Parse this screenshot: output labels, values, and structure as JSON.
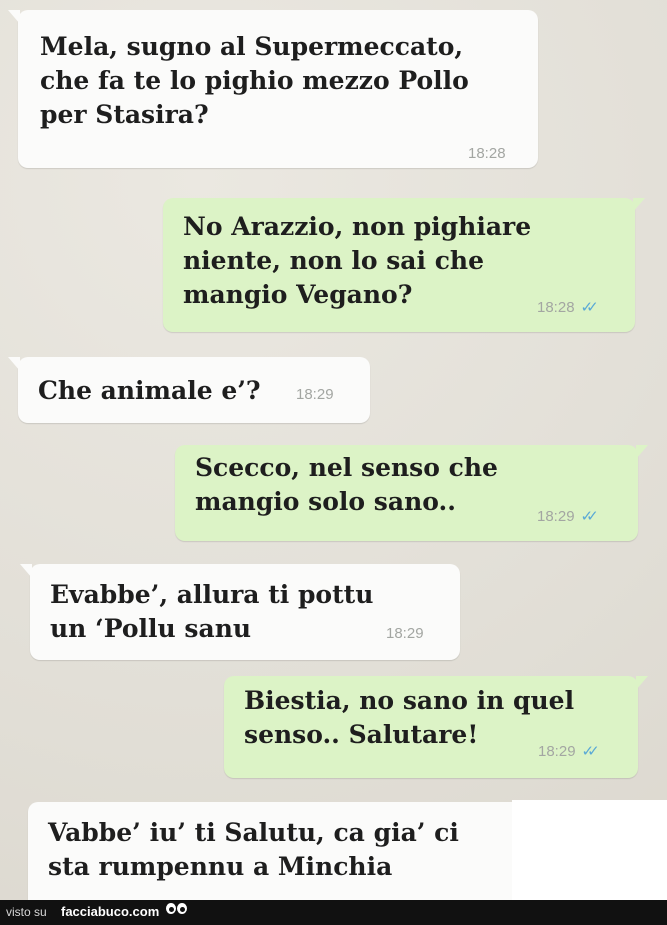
{
  "messages": [
    {
      "text": "Mela, sugno al Supermeccato,\nche fa te lo pighio mezzo Pollo\nper Stasira?",
      "time": "18:28"
    },
    {
      "text": "No Arazzio, non pighiare\nniente, non lo sai che\nmangio Vegano?",
      "time": "18:28",
      "status": "read"
    },
    {
      "text": "Che animale e’?",
      "time": "18:29"
    },
    {
      "text": "Scecco, nel senso che\nmangio solo sano..",
      "time": "18:29",
      "status": "read"
    },
    {
      "text": "Evabbe’, allura ti pottu\n un ‘Pollu sanu",
      "time": "18:29"
    },
    {
      "text": "Biestia, no sano in quel\nsenso.. Salutare!",
      "time": "18:29",
      "status": "read"
    },
    {
      "text": "Vabbe’ iu’ ti Salutu, ca gia’ ci\nsta rumpennu a Minchia",
      "time": ""
    }
  ],
  "icons": {
    "read_receipt": "double-check-icon",
    "mascot": "eyes-icon"
  },
  "colors": {
    "incoming": "#fbfbfa",
    "outgoing": "#dcf3c6",
    "ticks": "#5aa9d6",
    "footer": "#111111"
  },
  "footer": {
    "visto": "visto su",
    "site": "facciabuco.com"
  }
}
